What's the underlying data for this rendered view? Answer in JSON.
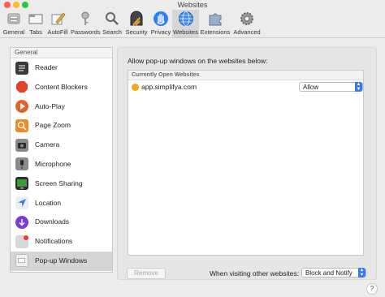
{
  "window": {
    "title": "Websites"
  },
  "toolbar": {
    "items": [
      {
        "label": "General",
        "icon": "general-switch-icon"
      },
      {
        "label": "Tabs",
        "icon": "tabs-icon"
      },
      {
        "label": "AutoFill",
        "icon": "pencil-autofill-icon"
      },
      {
        "label": "Passwords",
        "icon": "key-icon"
      },
      {
        "label": "Search",
        "icon": "magnifier-icon"
      },
      {
        "label": "Security",
        "icon": "security-gate-icon"
      },
      {
        "label": "Privacy",
        "icon": "hand-icon"
      },
      {
        "label": "Websites",
        "icon": "globe-icon",
        "active": true
      },
      {
        "label": "Extensions",
        "icon": "puzzle-icon"
      },
      {
        "label": "Advanced",
        "icon": "gear-icon"
      }
    ]
  },
  "sidebar": {
    "header": "General",
    "items": [
      {
        "label": "Reader",
        "icon": "reader-icon",
        "color": "#3a3a3a"
      },
      {
        "label": "Content Blockers",
        "icon": "stop-icon",
        "color": "#e0432c"
      },
      {
        "label": "Auto-Play",
        "icon": "play-icon",
        "color": "#e0632c"
      },
      {
        "label": "Page Zoom",
        "icon": "zoom-icon",
        "color": "#f08a24"
      },
      {
        "label": "Camera",
        "icon": "camera-icon",
        "color": "#8a8a8a"
      },
      {
        "label": "Microphone",
        "icon": "microphone-icon",
        "color": "#8a8a8a"
      },
      {
        "label": "Screen Sharing",
        "icon": "screen-sharing-icon",
        "color": "#3b9b3b"
      },
      {
        "label": "Location",
        "icon": "location-icon",
        "color": "#3478f6"
      },
      {
        "label": "Downloads",
        "icon": "download-icon",
        "color": "#7a3bd6"
      },
      {
        "label": "Notifications",
        "icon": "notifications-icon",
        "color": "#c8c8c8"
      },
      {
        "label": "Pop-up Windows",
        "icon": "popup-window-icon",
        "color": "#e2e2e2",
        "selected": true
      }
    ]
  },
  "pane": {
    "title": "Allow pop-up windows on the websites below:",
    "list_header": "Currently Open Websites",
    "sites": [
      {
        "name": "app.simplifya.com",
        "setting": "Allow"
      }
    ],
    "remove_label": "Remove",
    "other_label": "When visiting other websites:",
    "other_setting": "Block and Notify"
  },
  "help_label": "?",
  "colors": {
    "accent": "#3478f6",
    "selection": "#d5d5d5"
  }
}
